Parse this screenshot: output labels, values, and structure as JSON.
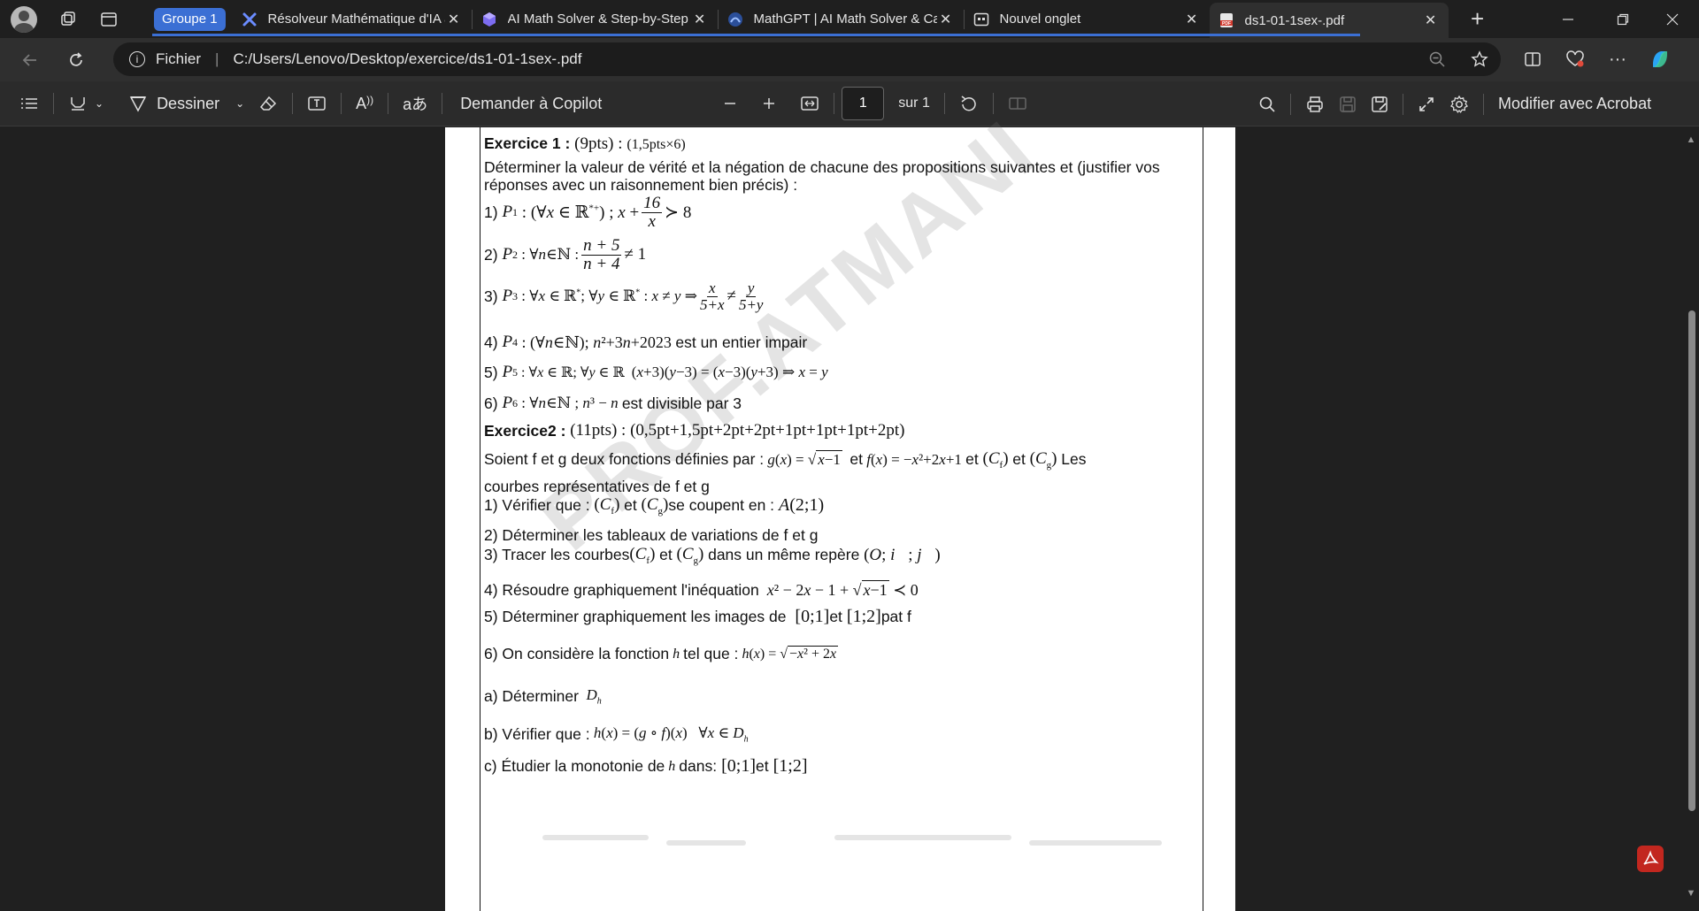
{
  "browser": {
    "tab_group_label": "Groupe 1",
    "tabs": [
      {
        "title": "Résolveur Mathématique d'IA à",
        "icon": "math-solver-icon"
      },
      {
        "title": "AI Math Solver & Step-by-Step",
        "icon": "cube-icon"
      },
      {
        "title": "MathGPT | AI Math Solver & Calc",
        "icon": "mathgpt-icon"
      },
      {
        "title": "Nouvel onglet",
        "icon": "new-tab-page-icon"
      },
      {
        "title": "ds1-01-1sex-.pdf",
        "icon": "pdf-icon",
        "active": true
      }
    ],
    "address": {
      "label": "Fichier",
      "url": "C:/Users/Lenovo/Desktop/exercice/ds1-01-1sex-.pdf"
    }
  },
  "pdf_toolbar": {
    "draw_label": "Dessiner",
    "copilot_label": "Demander à Copilot",
    "page_number": "1",
    "page_total": "sur 1",
    "acrobat_label": "Modifier avec Acrobat"
  },
  "document": {
    "ex1_title": "Exercice 1 :",
    "ex1_points": "(9pts) :",
    "ex1_detail": "(1,5pts×6)",
    "ex1_instruction_1": "Déterminer la valeur de vérité et la négation de chacune des propositions suivantes et (justifier vos",
    "ex1_instruction_2": "réponses avec un raisonnement bien précis) :",
    "p4_text": "est un entier impair",
    "p6_text": "est divisible par 3",
    "ex2_title": "Exercice2 :",
    "ex2_points": "(11pts) :",
    "ex2_detail": "(0,5pt+1,5pt+2pt+2pt+1pt+1pt+1pt+2pt)",
    "ex2_intro_1a": "Soient f et g deux fonctions définies par :",
    "ex2_intro_1b": "et",
    "ex2_intro_1c": "et",
    "ex2_intro_1d": "et",
    "ex2_intro_1e": "Les",
    "ex2_intro_2": "courbes représentatives de f et g",
    "q1": "1) Vérifier que :",
    "q1b": "et",
    "q1c": "se coupent en :",
    "q2": "2) Déterminer les tableaux de variations de f et g",
    "q3": "3) Tracer les courbes",
    "q3b": "et",
    "q3c": "dans un même repère",
    "q4": "4) Résoudre graphiquement l'inéquation",
    "q5": "5) Déterminer graphiquement les images de",
    "q5b": "et",
    "q5c": "pat f",
    "q6": "6) On considère la fonction",
    "q6b": "tel que :",
    "qa": "a) Déterminer",
    "qb": "b) Vérifier que :",
    "qc": "c) Étudier la monotonie de",
    "qc2": "dans:",
    "qc3": "et",
    "watermark": "PROF.ATMANI"
  }
}
